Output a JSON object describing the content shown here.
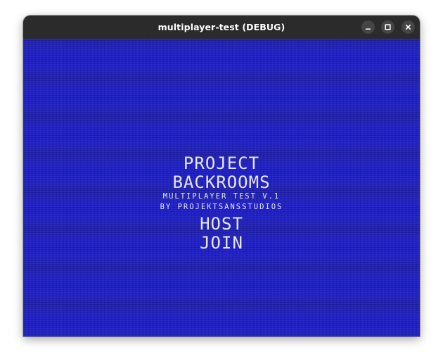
{
  "window": {
    "title": "multiplayer-test (DEBUG)",
    "controls": {
      "minimize": "minimize",
      "maximize": "maximize",
      "close": "close"
    }
  },
  "menu": {
    "title_line1": "PROJECT",
    "title_line2": "BACKROOMS",
    "subtitle_line1": "MULTIPLAYER TEST V.1",
    "subtitle_line2": "BY PROJEKTSANSSTUDIOS",
    "host_label": "HOST",
    "join_label": "JOIN"
  },
  "colors": {
    "background": "#2222c4",
    "text": "#e6e7f2",
    "titlebar": "#2b2b2b"
  }
}
